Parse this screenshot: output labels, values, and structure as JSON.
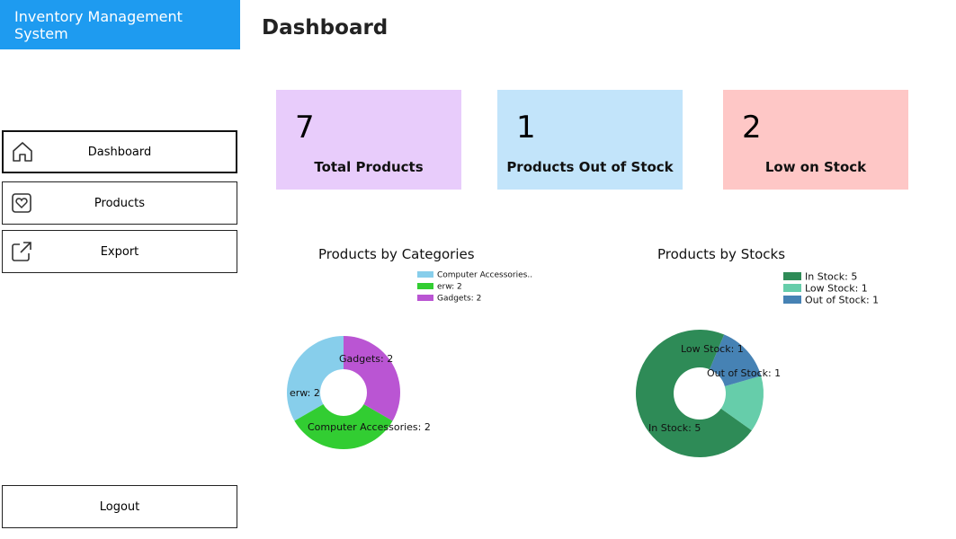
{
  "app": {
    "title": "Inventory Management System"
  },
  "page": {
    "title": "Dashboard"
  },
  "sidebar": {
    "items": [
      {
        "label": "Dashboard",
        "icon": "home-icon"
      },
      {
        "label": "Products",
        "icon": "heart-box-icon"
      },
      {
        "label": "Export",
        "icon": "external-link-icon"
      }
    ],
    "logout_label": "Logout"
  },
  "cards": [
    {
      "value": "7",
      "label": "Total Products",
      "color": "#e8ccfb"
    },
    {
      "value": "1",
      "label": "Products Out of Stock",
      "color": "#c2e4fa"
    },
    {
      "value": "2",
      "label": "Low on Stock",
      "color": "#fec7c6"
    }
  ],
  "chart_data": [
    {
      "type": "pie",
      "title": "Products by Categories",
      "categories": [
        "Computer Accessories",
        "erw",
        "Gadgets"
      ],
      "values": [
        2,
        2,
        2
      ],
      "colors": [
        "#87ceeb",
        "#32cd32",
        "#ba55d3"
      ],
      "legend": [
        "Computer  Accessories..",
        "erw: 2",
        "Gadgets: 2"
      ],
      "slice_labels": [
        "Computer Accessories: 2",
        "erw: 2",
        "Gadgets: 2"
      ],
      "legend_position": "top-right",
      "donut": true
    },
    {
      "type": "pie",
      "title": "Products by Stocks",
      "categories": [
        "In Stock",
        "Low Stock",
        "Out of Stock"
      ],
      "values": [
        5,
        1,
        1
      ],
      "colors": [
        "#2e8b57",
        "#66cdaa",
        "#4682b4"
      ],
      "legend": [
        "In Stock: 5",
        "Low Stock: 1",
        "Out of Stock: 1"
      ],
      "slice_labels": [
        "In Stock: 5",
        "Low Stock: 1",
        "Out of Stock: 1"
      ],
      "legend_position": "top-right",
      "donut": true
    }
  ]
}
